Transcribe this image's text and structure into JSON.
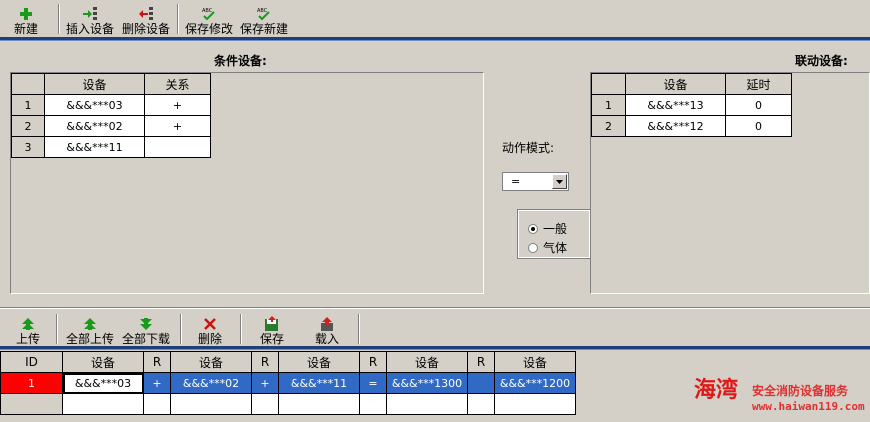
{
  "top_toolbar": {
    "new_label": "新建",
    "insert_label": "插入设备",
    "delete_label": "删除设备",
    "save_edit_label": "保存修改",
    "save_new_label": "保存新建"
  },
  "condition": {
    "title": "条件设备:",
    "headers": [
      "设备",
      "关系"
    ],
    "rows": [
      {
        "n": "1",
        "device": "&&&***03",
        "rel": "+"
      },
      {
        "n": "2",
        "device": "&&&***02",
        "rel": "+"
      },
      {
        "n": "3",
        "device": "&&&***11",
        "rel": ""
      }
    ]
  },
  "action": {
    "mode_label": "动作模式:",
    "mode_value": "=",
    "radio_general": "一般",
    "radio_gas": "气体"
  },
  "linkage": {
    "title": "联动设备:",
    "headers": [
      "设备",
      "延时"
    ],
    "rows": [
      {
        "n": "1",
        "device": "&&&***13",
        "delay": "0"
      },
      {
        "n": "2",
        "device": "&&&***12",
        "delay": "0"
      }
    ]
  },
  "bottom_toolbar": {
    "upload_label": "上传",
    "upload_all_label": "全部上传",
    "download_all_label": "全部下载",
    "delete_label": "删除",
    "save_label": "保存",
    "load_label": "载入"
  },
  "bottom_table": {
    "headers": [
      "ID",
      "设备",
      "R",
      "设备",
      "R",
      "设备",
      "R",
      "设备",
      "R",
      "设备"
    ],
    "row": [
      "1",
      "&&&***03",
      "+",
      "&&&***02",
      "+",
      "&&&***11",
      "=",
      "&&&***1300",
      "",
      "&&&***1200"
    ]
  },
  "watermark": {
    "brand": "海湾",
    "tagline": "安全消防设备服务",
    "url": "www.haiwan119.com"
  },
  "colors": {
    "selection": "#316ac5",
    "id_cell": "#ff0000",
    "bar": "#1f3f78"
  }
}
